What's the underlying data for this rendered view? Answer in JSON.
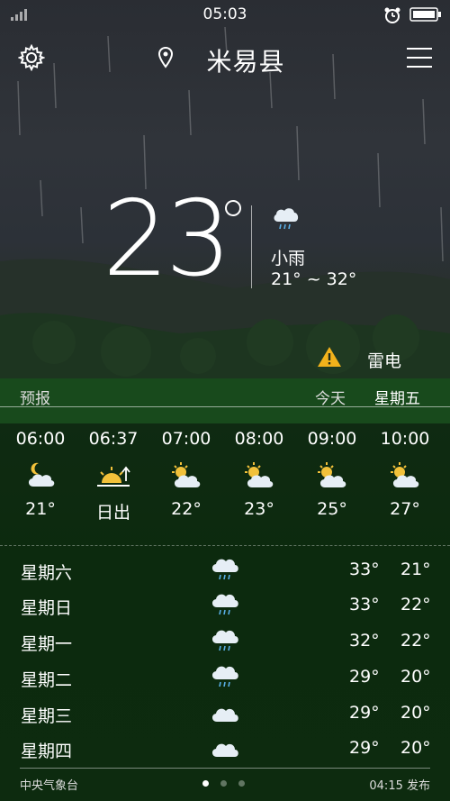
{
  "status_bar": {
    "time": "05:03"
  },
  "header": {
    "city": "米易县",
    "settings_icon": "gear-icon",
    "menu_icon": "hamburger-menu-icon",
    "location_icon": "location-pin-icon"
  },
  "current": {
    "temperature": "23",
    "condition": "小雨",
    "range": "21° ~ 32°",
    "icon": "cloud-rain-icon"
  },
  "alert": {
    "label": "雷电",
    "icon": "warning-triangle-icon",
    "color": "#f2b21b"
  },
  "forecast_header": {
    "label": "预报",
    "today": "今天",
    "weekday": "星期五"
  },
  "hourly": [
    {
      "time": "06:00",
      "value": "21°",
      "icon": "moon-cloud-icon"
    },
    {
      "time": "06:37",
      "value": "日出",
      "icon": "sunrise-icon"
    },
    {
      "time": "07:00",
      "value": "22°",
      "icon": "sun-cloud-icon"
    },
    {
      "time": "08:00",
      "value": "23°",
      "icon": "sun-cloud-icon"
    },
    {
      "time": "09:00",
      "value": "25°",
      "icon": "sun-cloud-icon"
    },
    {
      "time": "10:00",
      "value": "27°",
      "icon": "sun-cloud-icon"
    }
  ],
  "daily": [
    {
      "day": "星期六",
      "hi": "33°",
      "lo": "21°",
      "icon": "cloud-rain-icon"
    },
    {
      "day": "星期日",
      "hi": "33°",
      "lo": "22°",
      "icon": "cloud-rain-icon"
    },
    {
      "day": "星期一",
      "hi": "32°",
      "lo": "22°",
      "icon": "cloud-rain-icon"
    },
    {
      "day": "星期二",
      "hi": "29°",
      "lo": "20°",
      "icon": "cloud-rain-icon"
    },
    {
      "day": "星期三",
      "hi": "29°",
      "lo": "20°",
      "icon": "cloud-icon"
    },
    {
      "day": "星期四",
      "hi": "29°",
      "lo": "20°",
      "icon": "cloud-icon"
    }
  ],
  "footer": {
    "source": "中央气象台",
    "published": "04:15 发布",
    "page_count": 3,
    "active_page": 1
  }
}
